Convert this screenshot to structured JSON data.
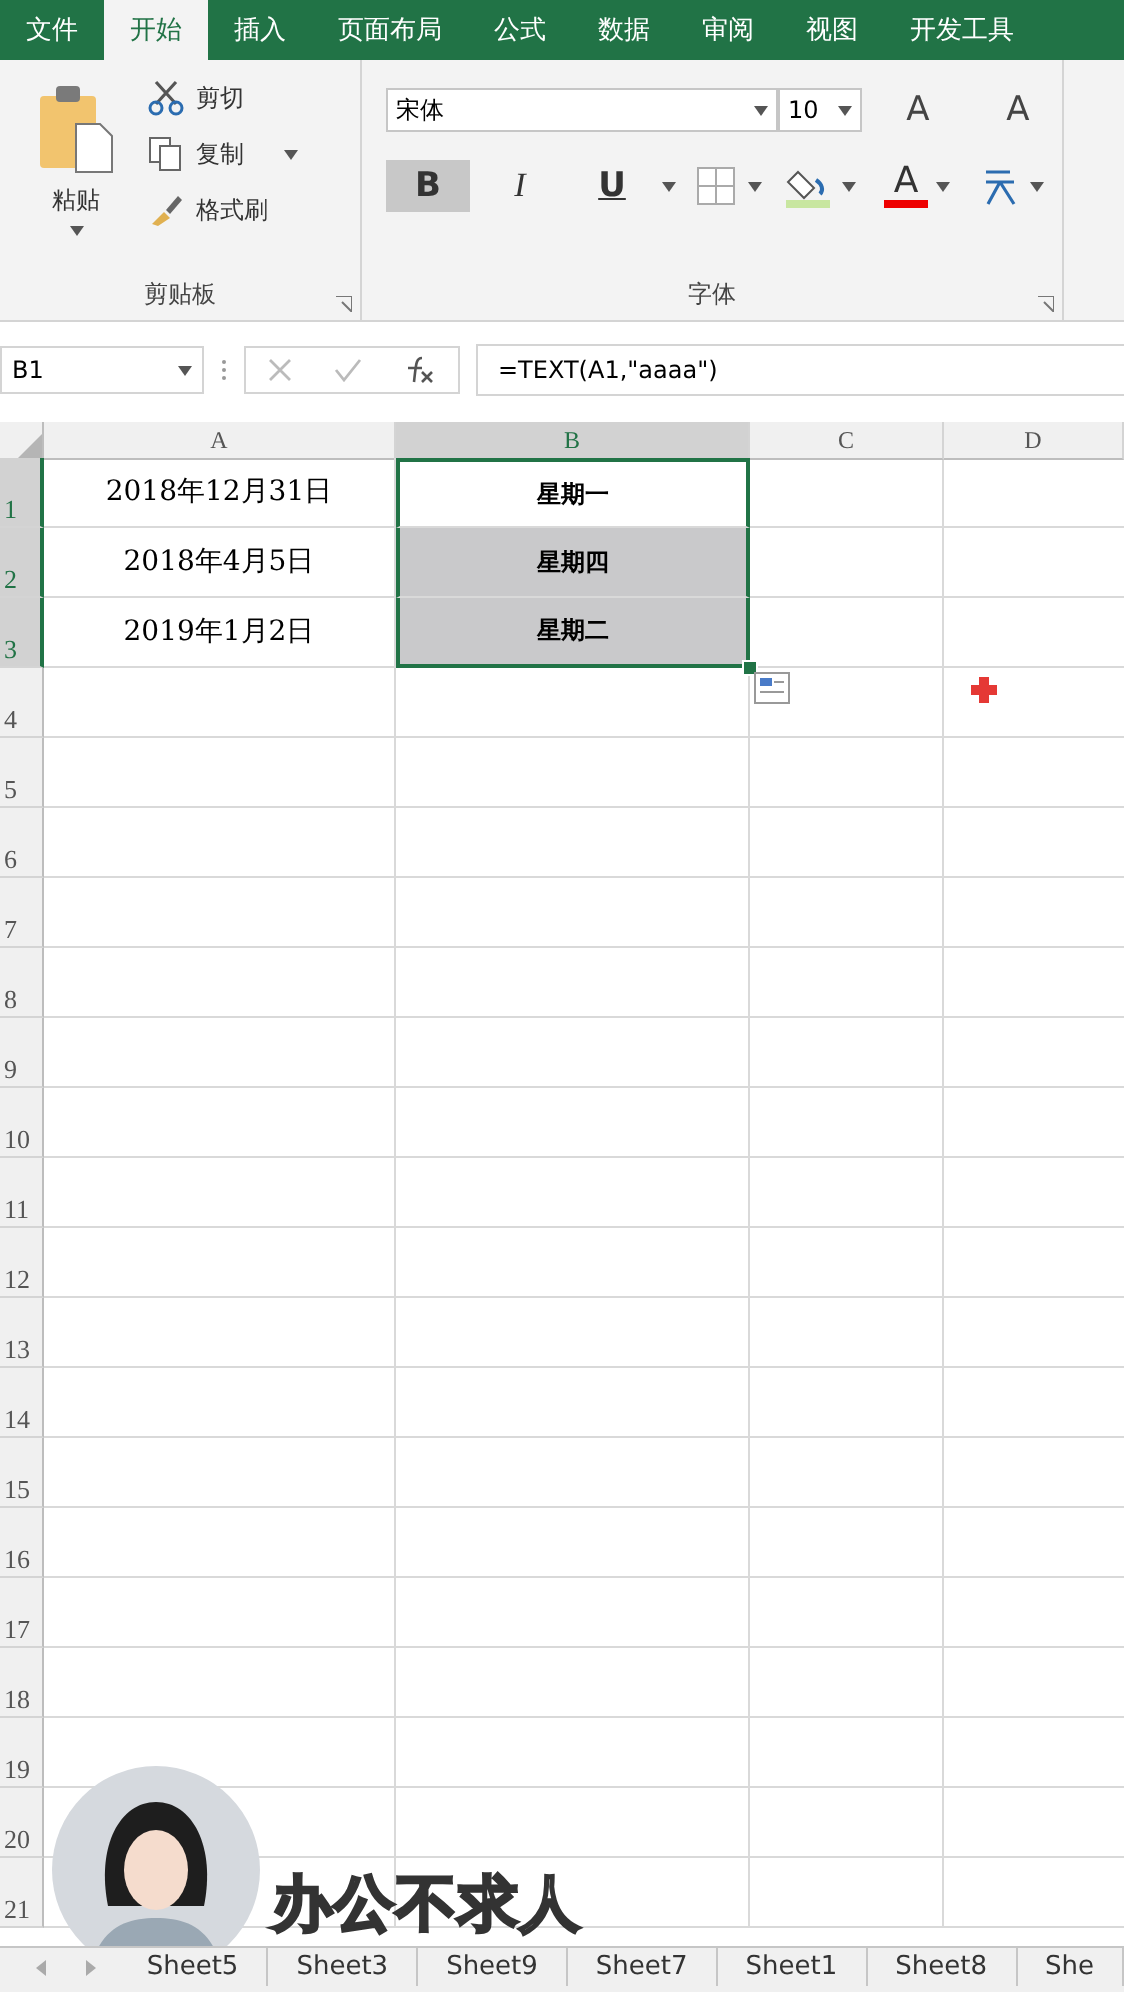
{
  "tabs": [
    {
      "label": "文件",
      "selected": false
    },
    {
      "label": "开始",
      "selected": true
    },
    {
      "label": "插入",
      "selected": false
    },
    {
      "label": "页面布局",
      "selected": false
    },
    {
      "label": "公式",
      "selected": false
    },
    {
      "label": "数据",
      "selected": false
    },
    {
      "label": "审阅",
      "selected": false
    },
    {
      "label": "视图",
      "selected": false
    },
    {
      "label": "开发工具",
      "selected": false
    }
  ],
  "clipboard": {
    "paste": "粘贴",
    "cut": "剪切",
    "copy": "复制",
    "format_painter": "格式刷",
    "group_label": "剪贴板"
  },
  "font": {
    "font_name": "宋体",
    "font_size": "10",
    "grow": "A",
    "shrink": "A",
    "bold": {
      "label": "B",
      "selected": true
    },
    "italic": {
      "label": "I",
      "selected": false
    },
    "underline": {
      "label": "U",
      "selected": false
    },
    "font_color": "A",
    "group_label": "字体"
  },
  "formula_bar": {
    "name_box": "B1",
    "formula": "=TEXT(A1,\"aaaa\")"
  },
  "sheet": {
    "columns": [
      {
        "label": "A",
        "selected": false
      },
      {
        "label": "B",
        "selected": true
      },
      {
        "label": "C",
        "selected": false
      },
      {
        "label": "D",
        "selected": false
      }
    ],
    "rows": [
      {
        "label": "1",
        "selected": true,
        "cells": [
          {
            "text": "2018年12月31日",
            "selected": false,
            "active": false
          },
          {
            "text": "星期一",
            "selected": true,
            "active": true
          }
        ]
      },
      {
        "label": "2",
        "selected": true,
        "cells": [
          {
            "text": "2018年4月5日",
            "selected": false,
            "active": false
          },
          {
            "text": "星期四",
            "selected": true,
            "active": false
          }
        ]
      },
      {
        "label": "3",
        "selected": true,
        "cells": [
          {
            "text": "2019年1月2日",
            "selected": false,
            "active": false
          },
          {
            "text": "星期二",
            "selected": true,
            "active": false
          }
        ]
      },
      {
        "label": "4",
        "selected": false,
        "cells": []
      },
      {
        "label": "5",
        "selected": false,
        "cells": []
      },
      {
        "label": "6",
        "selected": false,
        "cells": []
      },
      {
        "label": "7",
        "selected": false,
        "cells": []
      },
      {
        "label": "8",
        "selected": false,
        "cells": []
      },
      {
        "label": "9",
        "selected": false,
        "cells": []
      },
      {
        "label": "10",
        "selected": false,
        "cells": []
      },
      {
        "label": "11",
        "selected": false,
        "cells": []
      },
      {
        "label": "12",
        "selected": false,
        "cells": []
      },
      {
        "label": "13",
        "selected": false,
        "cells": []
      },
      {
        "label": "14",
        "selected": false,
        "cells": []
      },
      {
        "label": "15",
        "selected": false,
        "cells": []
      },
      {
        "label": "16",
        "selected": false,
        "cells": []
      },
      {
        "label": "17",
        "selected": false,
        "cells": []
      },
      {
        "label": "18",
        "selected": false,
        "cells": []
      },
      {
        "label": "19",
        "selected": false,
        "cells": []
      },
      {
        "label": "20",
        "selected": false,
        "cells": []
      },
      {
        "label": "21",
        "selected": false,
        "cells": []
      }
    ]
  },
  "caption": "办公不求人",
  "sheet_tabs": [
    {
      "label": "Sheet5",
      "selected": false
    },
    {
      "label": "Sheet3",
      "selected": false
    },
    {
      "label": "Sheet9",
      "selected": false
    },
    {
      "label": "Sheet7",
      "selected": false
    },
    {
      "label": "Sheet1",
      "selected": false
    },
    {
      "label": "Sheet8",
      "selected": false
    },
    {
      "label": "She",
      "selected": false
    }
  ]
}
